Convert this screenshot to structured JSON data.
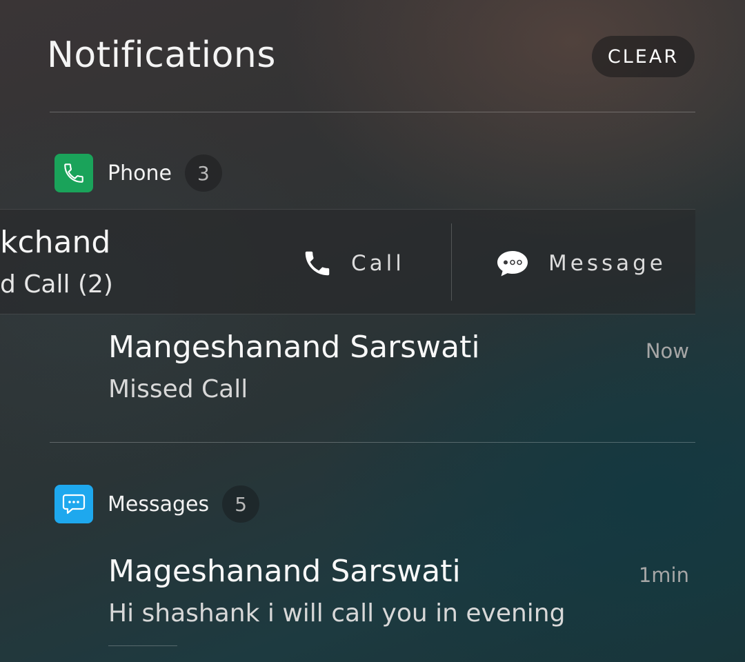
{
  "header": {
    "title": "Notifications",
    "clear_label": "CLEAR"
  },
  "phone_group": {
    "app_name": "Phone",
    "count": "3",
    "icon": "phone-icon",
    "color": "#1aa35a",
    "swiped_item": {
      "name": "kchand",
      "subtitle": "d Call (2)",
      "actions": {
        "call_label": "Call",
        "message_label": "Message"
      }
    },
    "item": {
      "name": "Mangeshanand Sarswati",
      "body": "Missed Call",
      "time": "Now"
    }
  },
  "messages_group": {
    "app_name": "Messages",
    "count": "5",
    "icon": "chat-bubble-icon",
    "color": "#1ea8ee",
    "item": {
      "name": "Mageshanand Sarswati",
      "body": "Hi shashank i will call you in evening",
      "time": "1min"
    }
  }
}
